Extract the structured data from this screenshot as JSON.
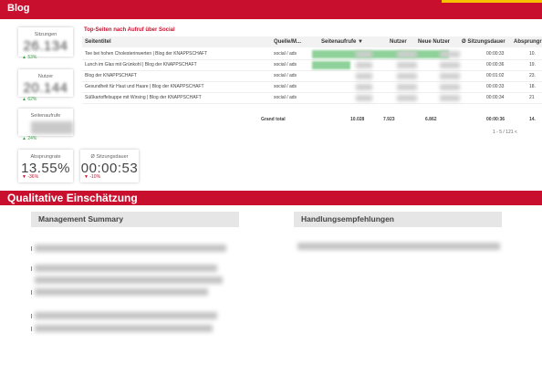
{
  "header": {
    "title": "Blog"
  },
  "kpis": [
    {
      "label": "Sitzungen",
      "value": "26.134",
      "delta": "▲ 53%",
      "trend": "up",
      "blurred": true
    },
    {
      "label": "Nutzer",
      "value": "20.144",
      "delta": "▲ 62%",
      "trend": "up",
      "blurred": true
    },
    {
      "label": "Seitenaufrufe",
      "value": "",
      "delta": "▲ 24%",
      "trend": "up",
      "blurred": true
    },
    {
      "label": "Absprungrate",
      "value": "13.55%",
      "delta": "▼ -36%",
      "trend": "down",
      "blurred": false
    },
    {
      "label": "Ø Sitzungsdauer",
      "value": "00:00:53",
      "delta": "▼ -10%",
      "trend": "down",
      "blurred": false
    }
  ],
  "table": {
    "title": "Top-Seiten nach Aufruf über Social",
    "columns": [
      "Seitentitel",
      "Quelle/M...",
      "Seitenaufrufe ▼",
      "Nutzer",
      "Neue Nutzer",
      "Ø Sitzungsdauer",
      "Absprungr"
    ],
    "rows": [
      {
        "title": "Tee bei hohen Cholesterinwerten | Blog der KNAPPSCHAFT",
        "source": "social / ads",
        "duration": "00:00:33",
        "bounce": "10.",
        "bar": 1.0
      },
      {
        "title": "Lunch im Glas mit Grünkohl | Blog der KNAPPSCHAFT",
        "source": "social / ads",
        "duration": "00:00:36",
        "bounce": "19.",
        "bar": 0.28
      },
      {
        "title": "Blog der KNAPPSCHAFT",
        "source": "social / ads",
        "duration": "00:01:02",
        "bounce": "23.",
        "bar": 0.0
      },
      {
        "title": "Gesundheit für Haut und Haare | Blog der KNAPPSCHAFT",
        "source": "social / ads",
        "duration": "00:00:33",
        "bounce": "18.",
        "bar": 0.0
      },
      {
        "title": "Süßkartoffelsuppe mit Wirsing | Blog der KNAPPSCHAFT",
        "source": "social / ads",
        "duration": "00:00:34",
        "bounce": "21",
        "bar": 0.0
      }
    ],
    "total": {
      "label": "Grand total",
      "views": "10.028",
      "users": "7.923",
      "new_users": "6.862",
      "duration": "00:00:36",
      "bounce": "14."
    },
    "pager": "1 - 5 / 121   <"
  },
  "section": {
    "title": "Qualitative Einschätzung"
  },
  "panels": {
    "left": "Management Summary",
    "right": "Handlungsempfehlungen"
  },
  "colors": {
    "brand": "#c8102e",
    "accent": "#f6c000",
    "bar": "#8fd19a"
  }
}
